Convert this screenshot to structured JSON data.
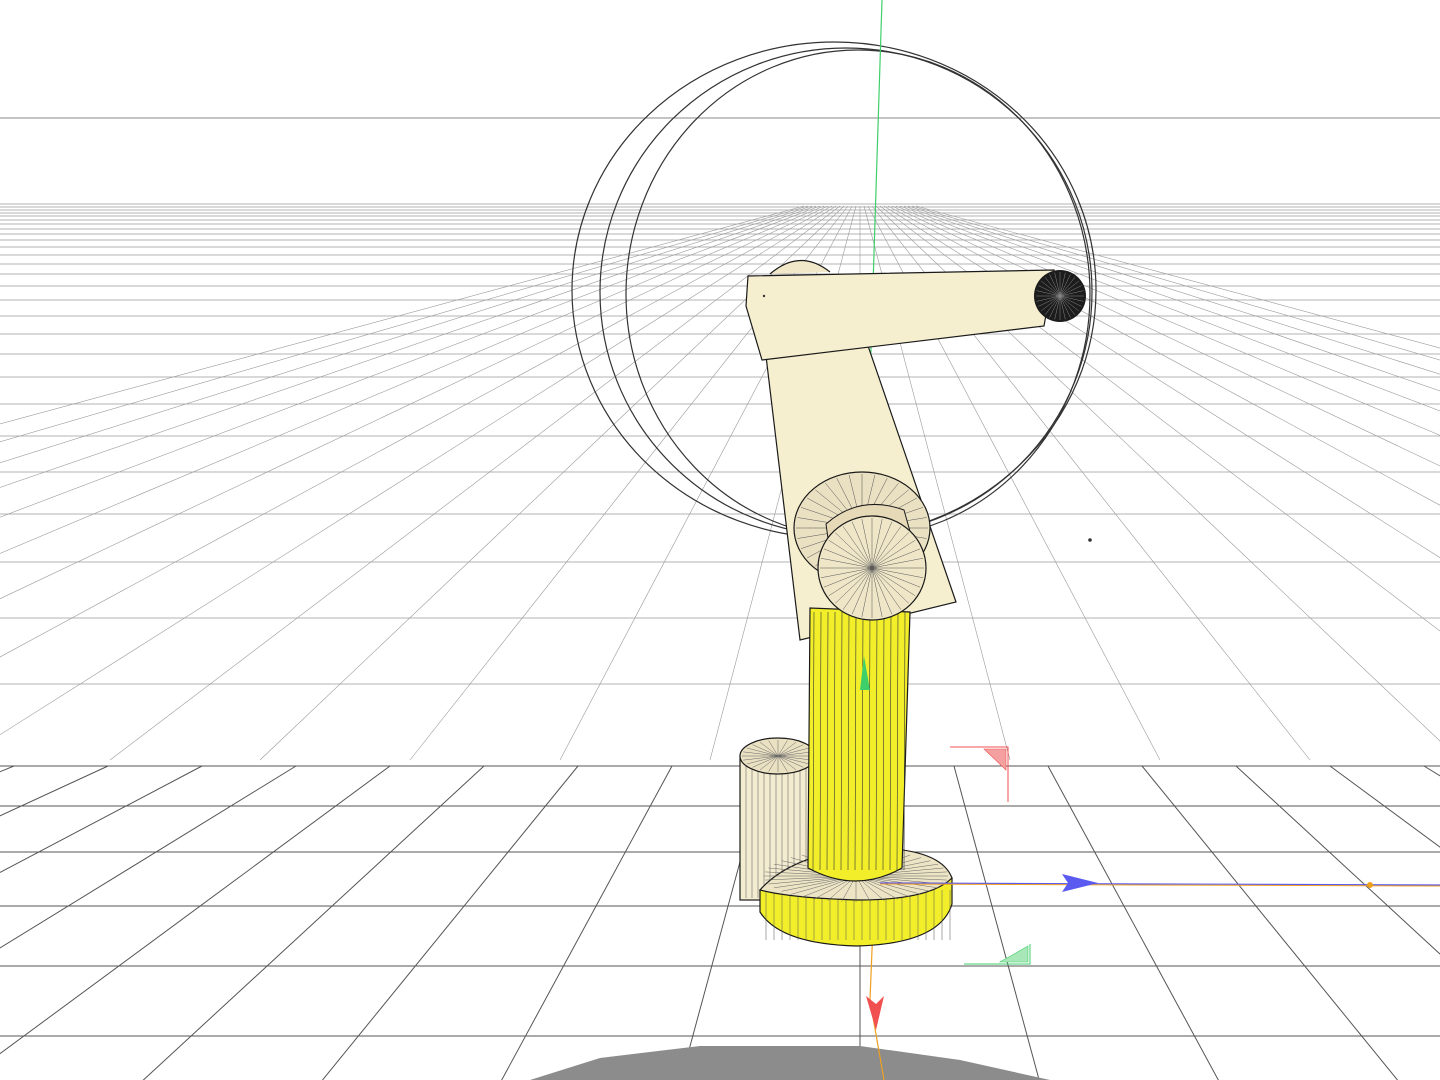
{
  "viewport": {
    "background": "#ffffff"
  },
  "colors": {
    "grid": "#9a9a9a",
    "grid_dark": "#555555",
    "horizon": "#8a8a8a",
    "base_yellow": "#f2ef2a",
    "base_yellow_dark": "#c9c400",
    "arm_cream": "#f5efcf",
    "joint_cream": "#eae0c2",
    "outline": "#1a1a1a",
    "axis_x": "#5a5af0",
    "axis_y": "#3fcf6a",
    "axis_z": "#f05050",
    "guide_orange": "#f0a020",
    "shadow": "#8c8c8c",
    "end_effector": "#1c1c1c"
  },
  "scene_objects": [
    "robot-base-plate",
    "robot-side-motor",
    "robot-column",
    "robot-shoulder-joint",
    "robot-upper-arm",
    "robot-forearm",
    "robot-end-effector",
    "rotation-gizmo",
    "translate-gizmo",
    "ground-grid",
    "ground-shadow"
  ]
}
